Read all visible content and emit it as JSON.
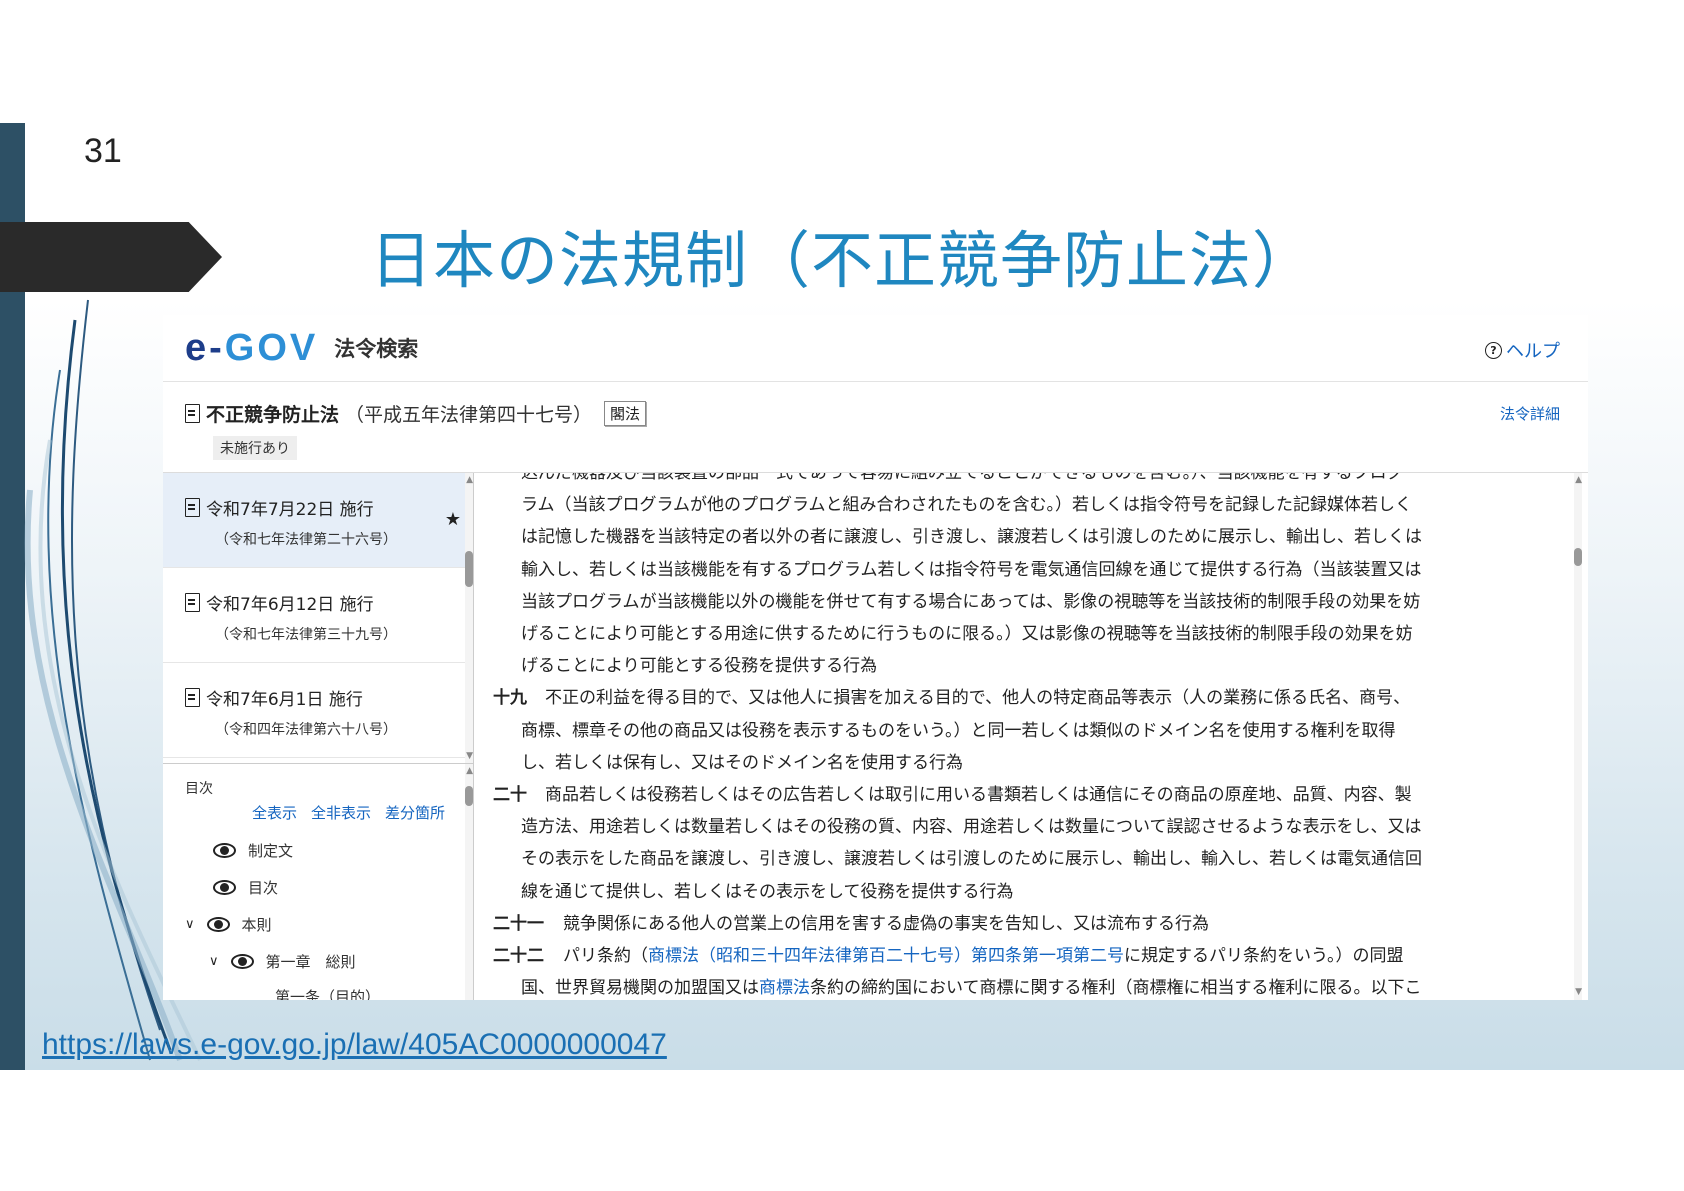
{
  "slide": {
    "number": "31",
    "title": "日本の法規制（不正競争防止法）",
    "link": "https://laws.e-gov.go.jp/law/405AC0000000047"
  },
  "egov": {
    "logo_e": "e-",
    "logo_gov": "GOV",
    "site_name": "法令検索",
    "help_label": "ヘルプ",
    "law_name": "不正競争防止法",
    "law_number": "（平成五年法律第四十七号）",
    "law_tag": "閣法",
    "pending_badge": "未施行あり",
    "detail_link": "法令詳細"
  },
  "versions": [
    {
      "date": "令和7年7月22日 施行",
      "sub": "（令和七年法律第二十六号）",
      "selected": true
    },
    {
      "date": "令和7年6月12日 施行",
      "sub": "（令和七年法律第三十九号）",
      "selected": false
    },
    {
      "date": "令和7年6月1日 施行",
      "sub": "（令和四年法律第六十八号）",
      "selected": false
    }
  ],
  "toc": {
    "heading": "目次",
    "links": [
      "全表示",
      "全非表示",
      "差分箇所"
    ],
    "items": [
      {
        "label": "制定文",
        "chevron": false,
        "indent": 0
      },
      {
        "label": "目次",
        "chevron": false,
        "indent": 0
      },
      {
        "label": "本則",
        "chevron": true,
        "indent": 0
      },
      {
        "label": "第一章　総則",
        "chevron": true,
        "indent": 1
      }
    ],
    "cut_item": "第一条（目的）"
  },
  "content": {
    "continuation": [
      "込んだ機器及び当該装置の部品一式であって容易に組み立てることができるものを含む。）、当該機能を有するプログ",
      "ラム（当該プログラムが他のプログラムと組み合わされたものを含む。）若しくは指令符号を記録した記録媒体若しく",
      "は記憶した機器を当該特定の者以外の者に譲渡し、引き渡し、譲渡若しくは引渡しのために展示し、輸出し、若しくは",
      "輸入し、若しくは当該機能を有するプログラム若しくは指令符号を電気通信回線を通じて提供する行為（当該装置又は",
      "当該プログラムが当該機能以外の機能を併せて有する場合にあっては、影像の視聴等を当該技術的制限手段の効果を妨",
      "げることにより可能とする用途に供するために行うものに限る。）又は影像の視聴等を当該技術的制限手段の効果を妨",
      "げることにより可能とする役務を提供する行為"
    ],
    "item19_num": "十九",
    "item19": [
      "不正の利益を得る目的で、又は他人に損害を加える目的で、他人の特定商品等表示（人の業務に係る氏名、商号、",
      "商標、標章その他の商品又は役務を表示するものをいう。）と同一若しくは類似のドメイン名を使用する権利を取得",
      "し、若しくは保有し、又はそのドメイン名を使用する行為"
    ],
    "item20_num": "二十",
    "item20": [
      "商品若しくは役務若しくはその広告若しくは取引に用いる書類若しくは通信にその商品の原産地、品質、内容、製",
      "造方法、用途若しくは数量若しくはその役務の質、内容、用途若しくは数量について誤認させるような表示をし、又は",
      "その表示をした商品を譲渡し、引き渡し、譲渡若しくは引渡しのために展示し、輸出し、輸入し、若しくは電気通信回",
      "線を通じて提供し、若しくはその表示をして役務を提供する行為"
    ],
    "item21_num": "二十一",
    "item21": "競争関係にある他人の営業上の信用を害する虚偽の事実を告知し、又は流布する行為",
    "item22_num": "二十二",
    "item22_a": "パリ条約（",
    "item22_link1": "商標法（昭和三十四年法律第百二十七号）第四条第一項第二号",
    "item22_b": "に規定するパリ条約をいう。）の同盟",
    "item22_c": "国、世界貿易機関の加盟国又は",
    "item22_link2": "商標法",
    "item22_d": "条約の締約国において商標に関する権利（商標権に相当する権利に限る。以下こ"
  }
}
